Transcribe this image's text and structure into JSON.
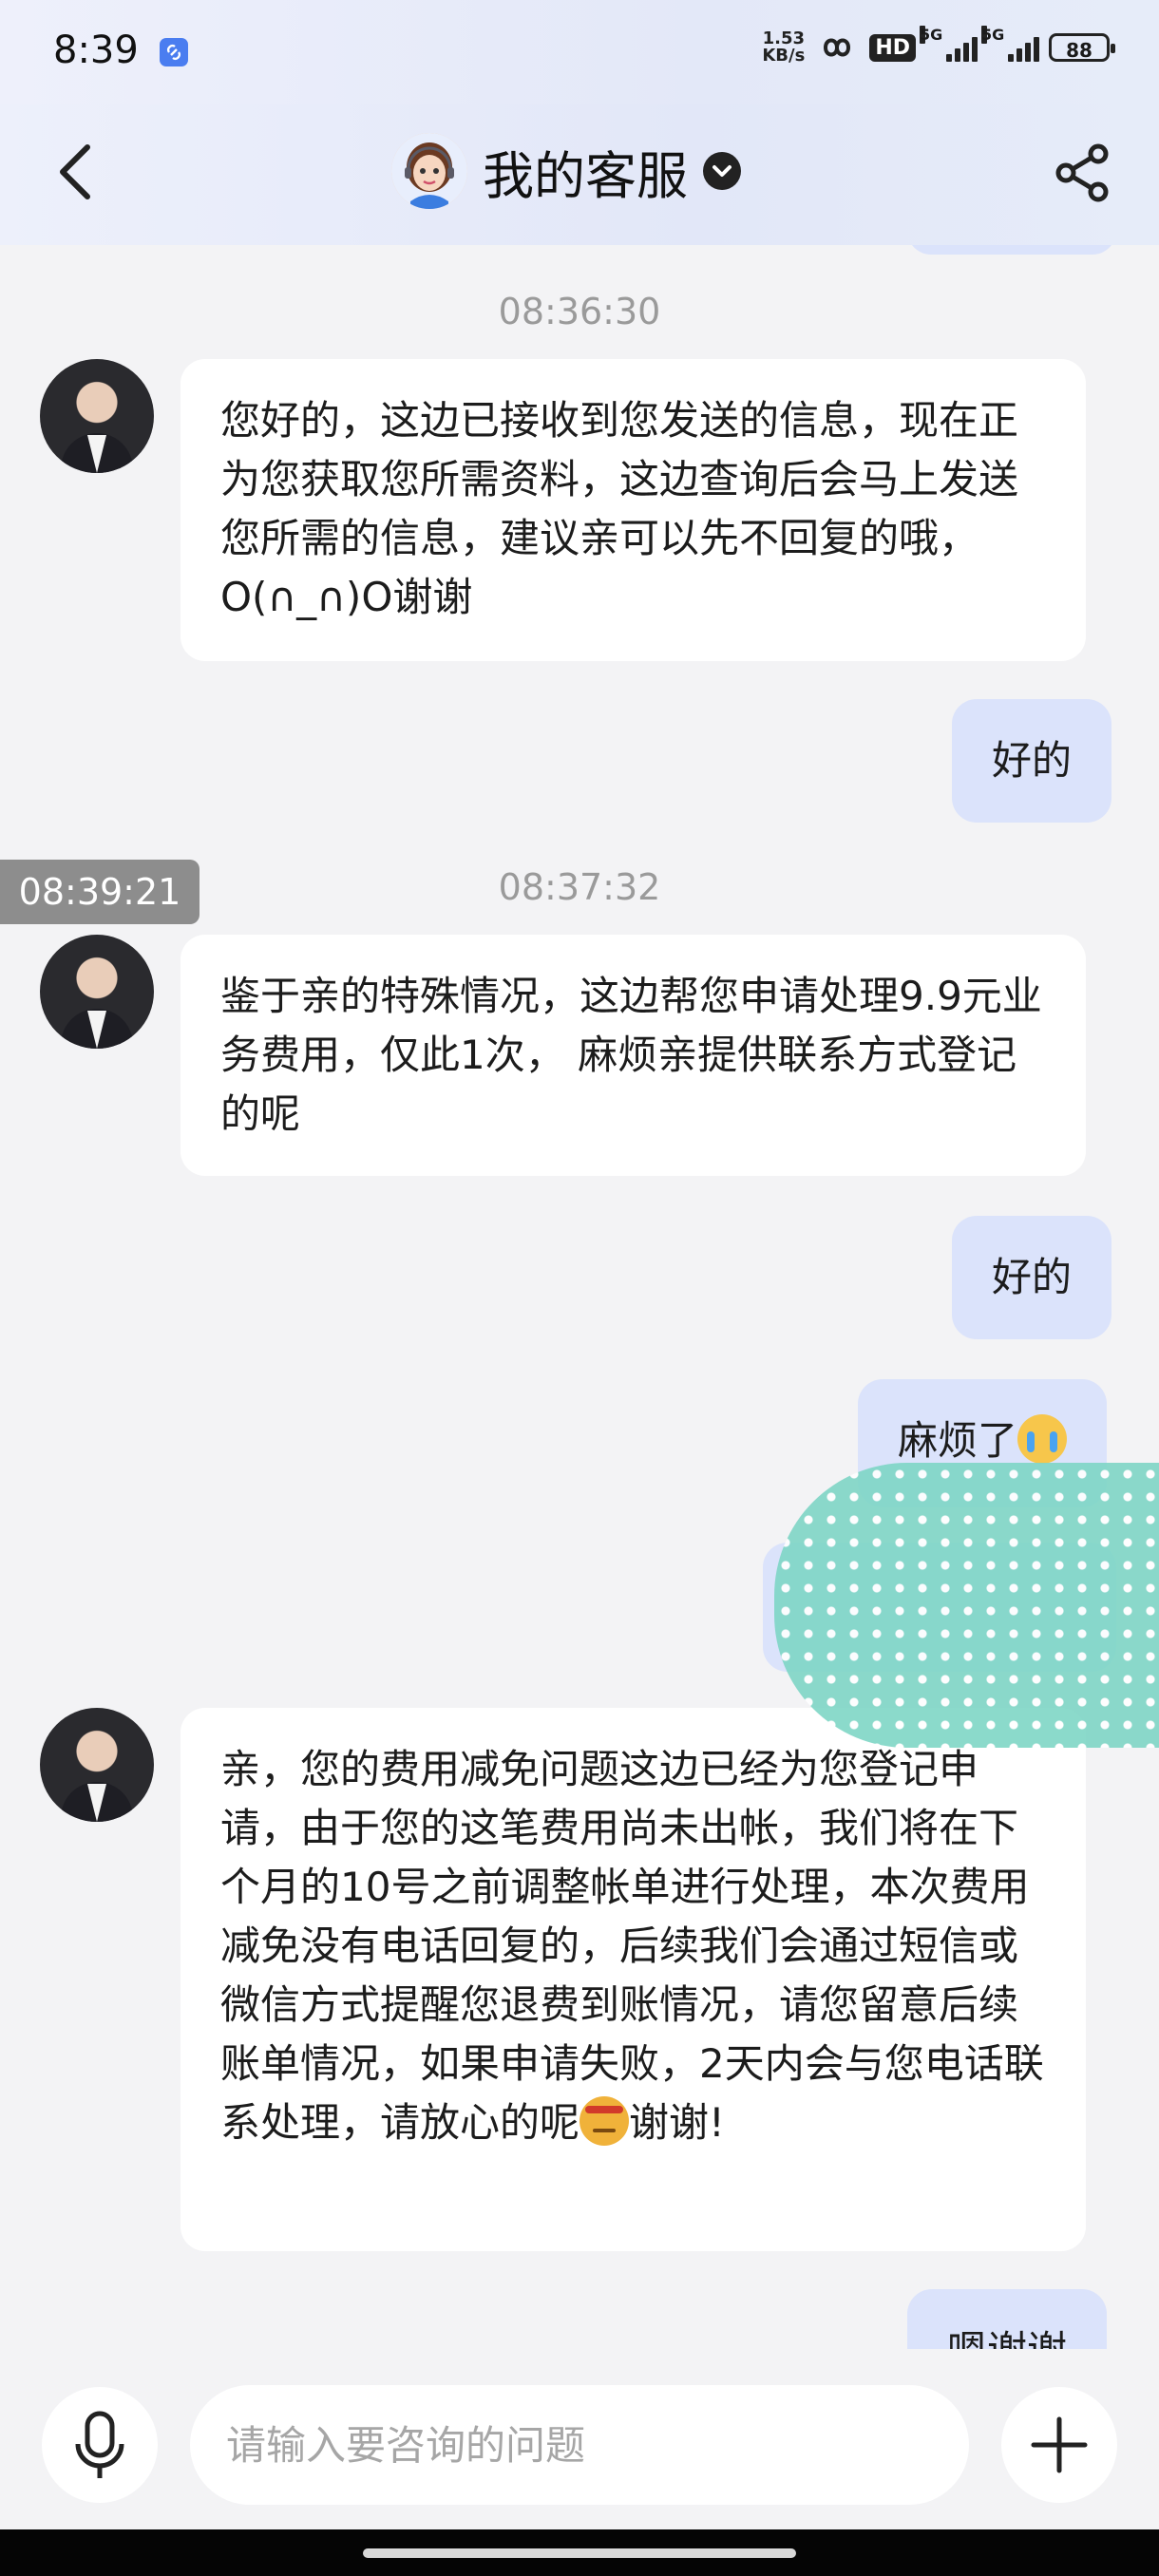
{
  "status_bar": {
    "time": "8:39",
    "net_speed_value": "1.53",
    "net_speed_unit": "KB/s",
    "hd_label": "HD",
    "signal1_label": "5G",
    "signal2_label": "5G",
    "battery": "88"
  },
  "header": {
    "title": "我的客服",
    "back_icon": "chevron-left-icon",
    "share_icon": "share-icon"
  },
  "chat": {
    "timestamps": [
      "08:36:30",
      "08:37:32"
    ],
    "selected_time_chip": "08:39:21",
    "messages": [
      {
        "side": "in",
        "text": "您好的，这边已接收到您发送的信息，现在正为您获取您所需资料，这边查询后会马上发送您所需的信息，建议亲可以先不回复的哦，O(∩_∩)O谢谢"
      },
      {
        "side": "out",
        "text": "好的"
      },
      {
        "side": "in",
        "text": "鉴于亲的特殊情况，这边帮您申请处理9.9元业务费用，仅此1次， 麻烦亲提供联系方式登记的呢"
      },
      {
        "side": "out",
        "text": "好的"
      },
      {
        "side": "out",
        "text": "麻烦了",
        "emoji": "crying-face"
      },
      {
        "side": "in",
        "text": "亲，您的费用减免问题这边已经为您登记申请，由于您的这笔费用尚未出帐，我们将在下个月的10号之前调整帐单进行处理，本次费用减免没有电话回复的，后续我们会通过短信或微信方式提醒您退费到账情况，请您留意后续账单情况，如果申请失败，2天内会与您电话联系处理，请放心的呢",
        "emoji": "smirk-face",
        "tail": "谢谢!"
      },
      {
        "side": "out",
        "text": "嗯谢谢"
      }
    ]
  },
  "input": {
    "placeholder": "请输入要咨询的问题"
  }
}
